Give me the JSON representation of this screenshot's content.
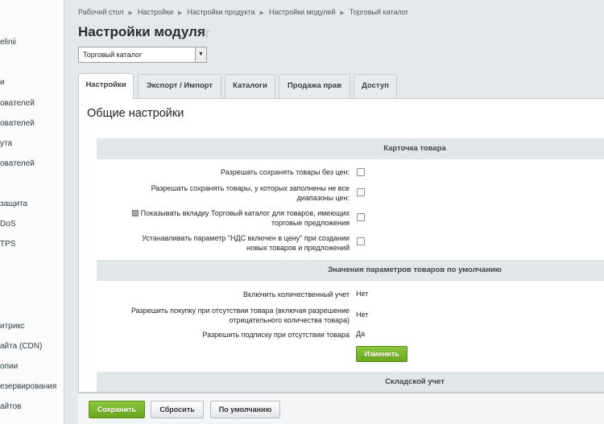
{
  "sidebar": {
    "items": [
      "elinii",
      "и",
      "ователей",
      "ователей",
      "ута",
      "ователей",
      "защита",
      "DoS",
      "TPS",
      "итрикс",
      "айта (CDN)",
      "опии",
      "езервирования",
      "айтов"
    ]
  },
  "breadcrumb": [
    "Рабочий стол",
    "Настройки",
    "Настройки продукта",
    "Настройки модулей",
    "Торговый каталог"
  ],
  "page_title": "Настройки модуля",
  "module_select": {
    "value": "Торговый каталог"
  },
  "tabs": [
    "Настройки",
    "Экспорт / Импорт",
    "Каталоги",
    "Продажа прав",
    "Доступ"
  ],
  "section_title": "Общие настройки",
  "groups": {
    "card": "Карточка товара",
    "defaults": "Значения параметров товаров по умолчанию",
    "warehouse": "Складской учет"
  },
  "card_options": [
    {
      "label": "Разрешать сохранять товары без цен:"
    },
    {
      "label": "Разрешать сохранять товары, у которых заполнены не все диапазоны цен:"
    },
    {
      "label": "Показывать вкладку Торговый каталог для товаров, имеющих торговые предложения"
    },
    {
      "label": "Устанавливать параметр \"НДС включен в цену\" при создании новых товаров и предложений"
    }
  ],
  "defaults_rows": [
    {
      "label": "Включить количественный учет",
      "value": "Нет"
    },
    {
      "label": "Разрешить покупку при отсутствии товара (включая разрешение отрицательного количества товара)",
      "value": "Нет"
    },
    {
      "label": "Разрешить подписку при отсутствии товара",
      "value": "Да"
    }
  ],
  "change_button": "Изменить",
  "footer": {
    "save": "Сохранить",
    "reset": "Сбросить",
    "default": "По умолчанию"
  }
}
